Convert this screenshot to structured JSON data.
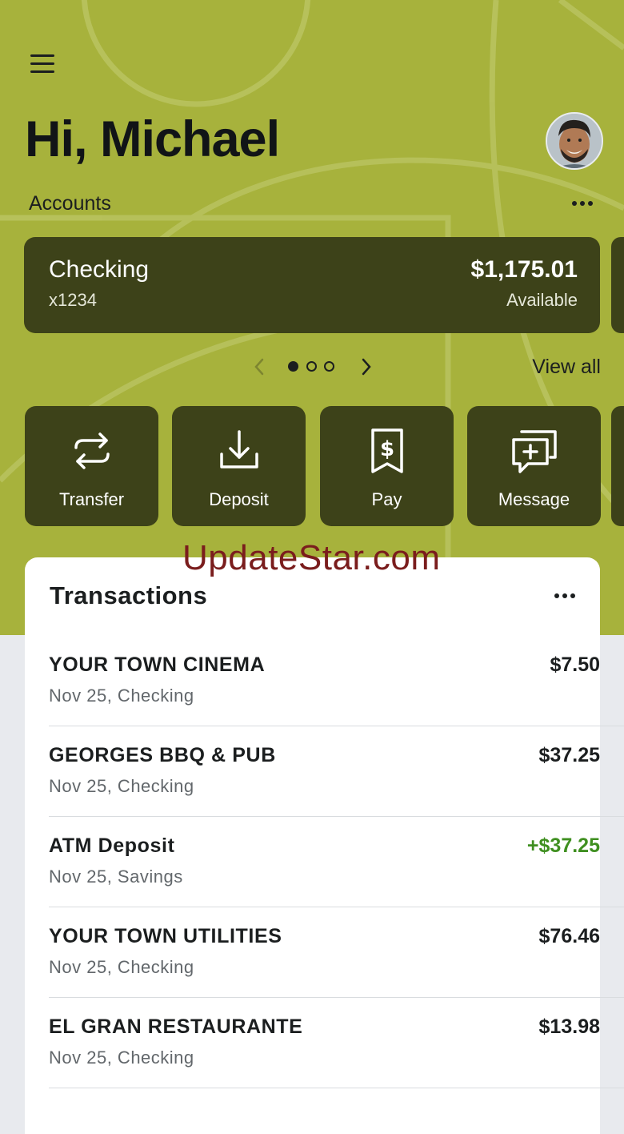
{
  "header": {
    "greeting": "Hi, Michael",
    "accounts_label": "Accounts"
  },
  "account_card": {
    "name": "Checking",
    "number": "x1234",
    "balance": "$1,175.01",
    "balance_label": "Available"
  },
  "pager": {
    "page_count": 3,
    "current_page": 1,
    "view_all": "View all"
  },
  "actions": [
    {
      "label": "Transfer",
      "icon": "transfer-arrows-icon"
    },
    {
      "label": "Deposit",
      "icon": "download-tray-icon"
    },
    {
      "label": "Pay",
      "icon": "dollar-receipt-icon"
    },
    {
      "label": "Message",
      "icon": "message-plus-icon"
    }
  ],
  "transactions": {
    "title": "Transactions",
    "items": [
      {
        "merchant": "YOUR TOWN CINEMA",
        "detail": "Nov 25, Checking",
        "amount": "$7.50",
        "credit": false
      },
      {
        "merchant": "GEORGES BBQ & PUB",
        "detail": "Nov 25, Checking",
        "amount": "$37.25",
        "credit": false
      },
      {
        "merchant": "ATM Deposit",
        "detail": "Nov 25, Savings",
        "amount": "+$37.25",
        "credit": true
      },
      {
        "merchant": "YOUR TOWN UTILITIES",
        "detail": "Nov 25, Checking",
        "amount": "$76.46",
        "credit": false
      },
      {
        "merchant": "EL GRAN RESTAURANTE",
        "detail": "Nov 25, Checking",
        "amount": "$13.98",
        "credit": false
      }
    ]
  },
  "watermark": "UpdateStar.com",
  "colors": {
    "hero": "#a7b23c",
    "card_dark": "#3d4219",
    "credit_green": "#3f8f20",
    "page_bg": "#e8eaee"
  }
}
